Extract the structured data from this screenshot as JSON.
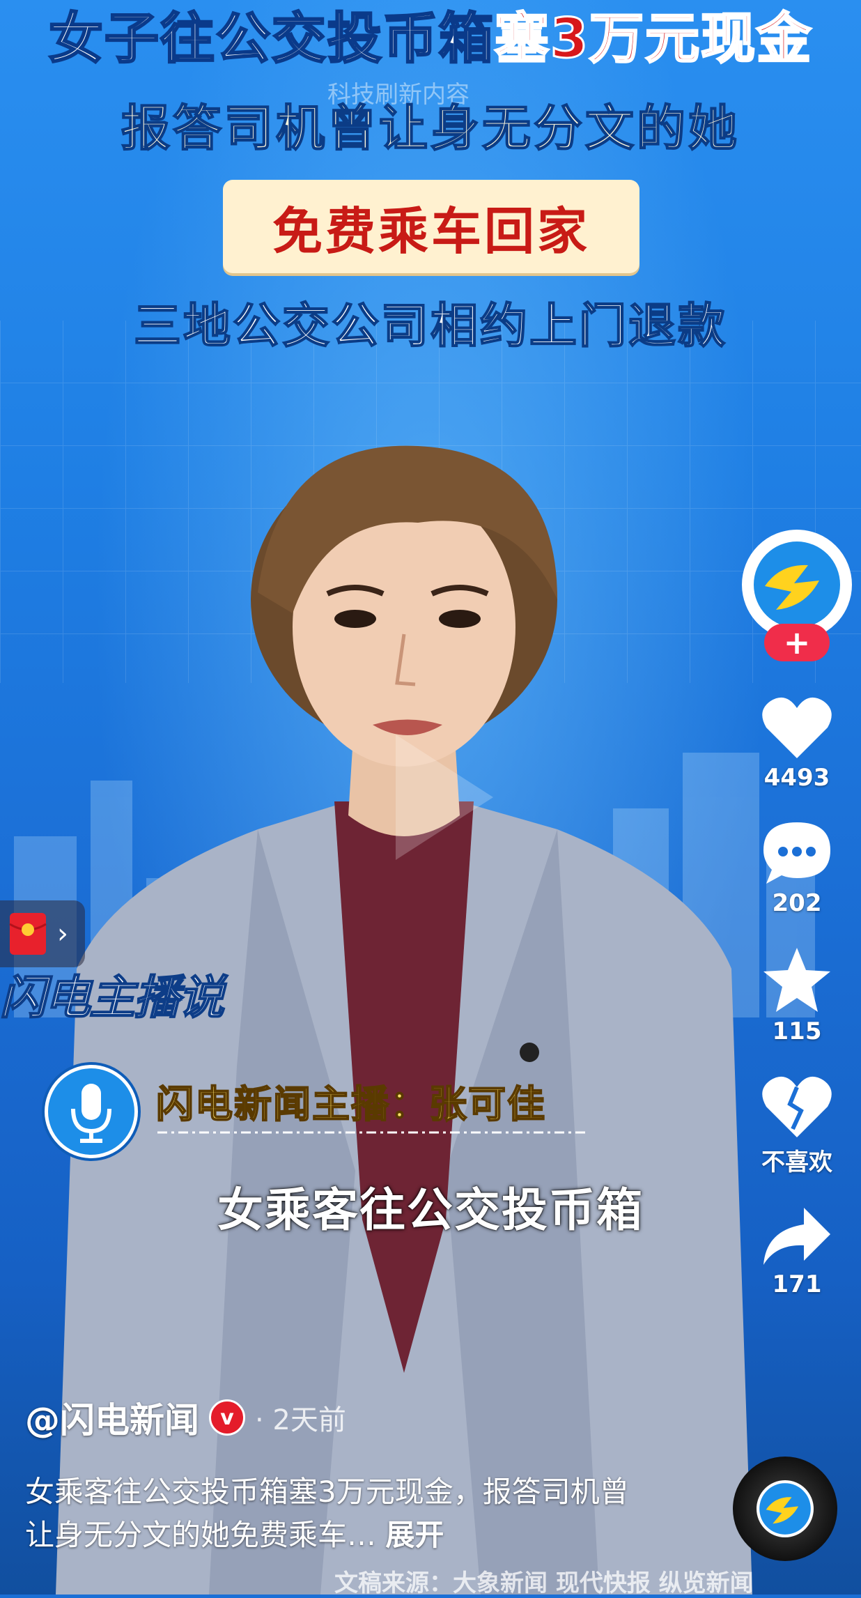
{
  "video": {
    "headline_white": "女子往公交投币箱",
    "headline_red": "塞3万元现金",
    "headline_line2": "报答司机曾让身无分文的她",
    "headline_pill": "免费乘车回家",
    "headline_line3": "三地公交公司相约上门退款",
    "watermark": "科技刷新内容",
    "program_logo": "闪电主播说",
    "anchor_label": "闪电新闻主播：张可佳",
    "subtitle": "女乘客往公交投币箱",
    "source_credit": "文稿来源：大象新闻 现代快报 纵览新闻"
  },
  "rail": {
    "likes": "4493",
    "comments": "202",
    "favorites": "115",
    "dislike_label": "不喜欢",
    "shares": "171",
    "follow_symbol": "+"
  },
  "redpack": {
    "chevron": "›"
  },
  "author": {
    "name": "@闪电新闻",
    "verified": "v",
    "time": "· 2天前"
  },
  "description": {
    "text": "女乘客往公交投币箱塞3万元现金，报答司机曾让身无分文的她免费乘车…",
    "more": "展开"
  },
  "colors": {
    "accent_red": "#d7181b",
    "follow_red": "#f02d4a",
    "brand_yellow": "#ffd21e",
    "brand_blue": "#1d8ee8"
  }
}
